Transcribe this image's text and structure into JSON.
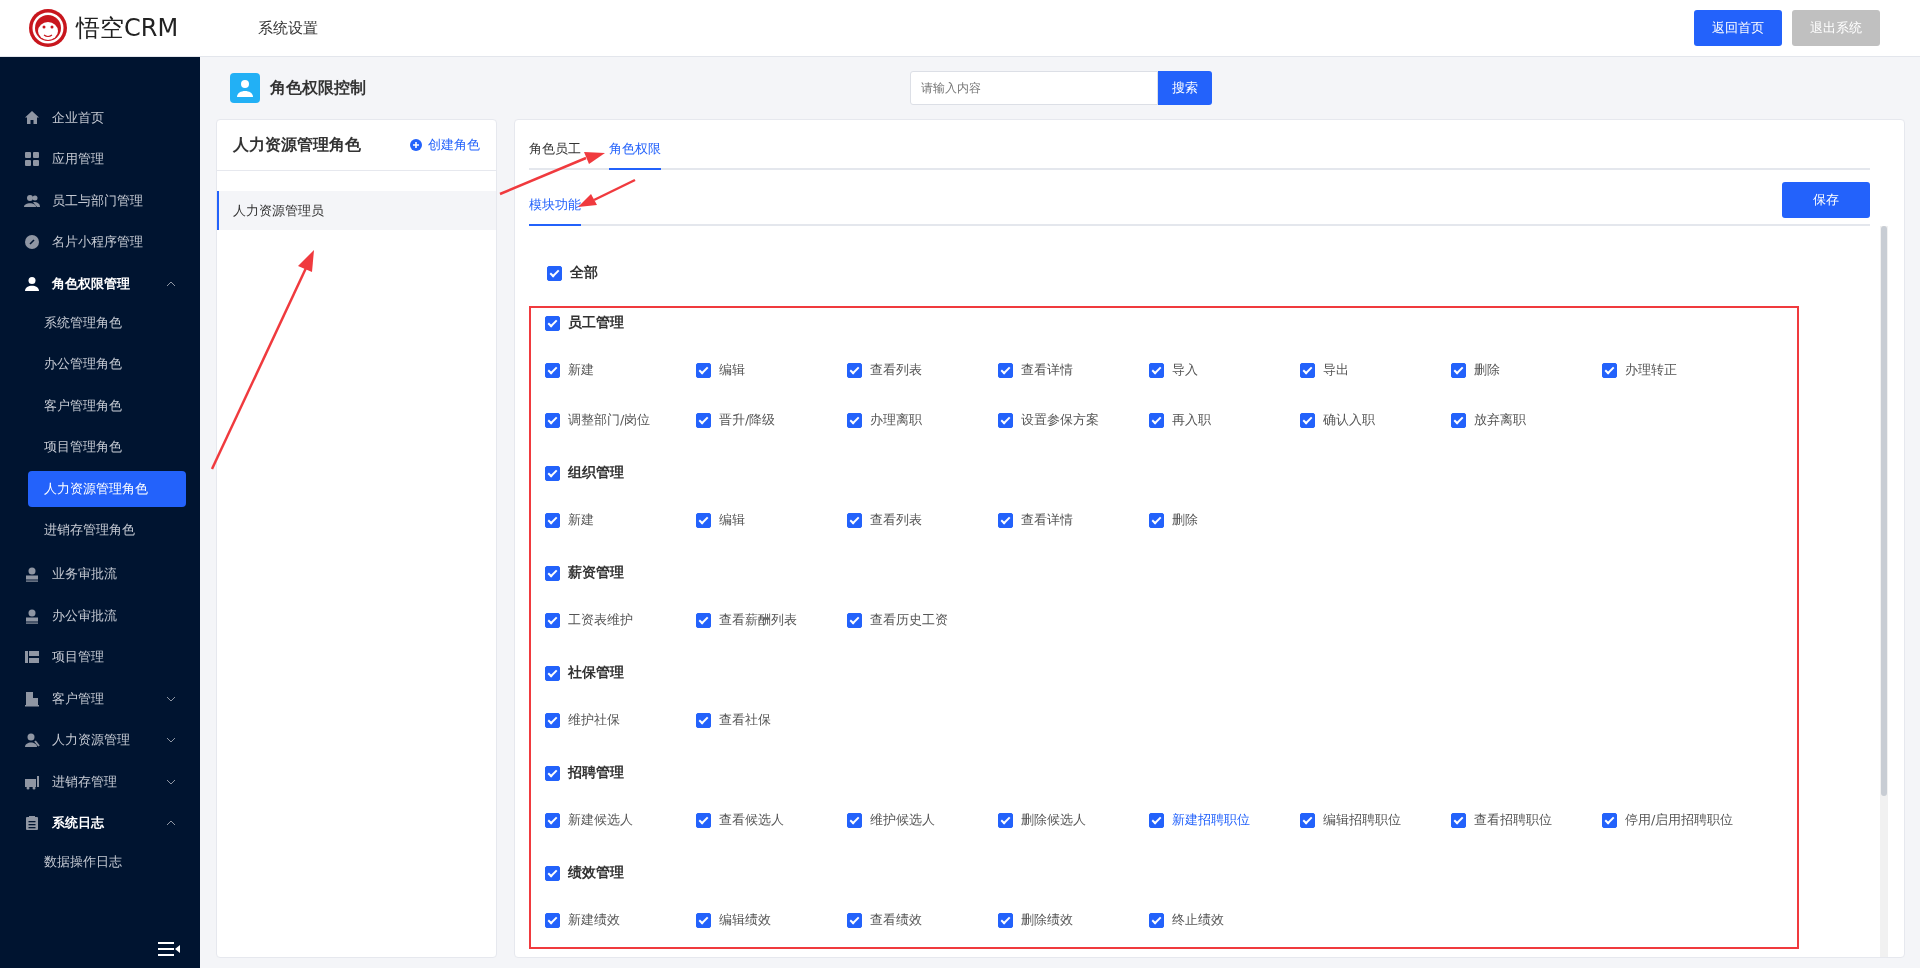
{
  "header": {
    "logo_text": "悟空CRM",
    "nav": [
      {
        "label": "系统设置"
      }
    ],
    "buttons": [
      {
        "label": "返回首页",
        "kind": "primary"
      },
      {
        "label": "退出系统",
        "kind": "muted"
      }
    ]
  },
  "sidebar": {
    "items": [
      {
        "label": "企业首页",
        "kind": "link"
      },
      {
        "label": "应用管理",
        "kind": "link"
      },
      {
        "label": "员工与部门管理",
        "kind": "link"
      },
      {
        "label": "名片小程序管理",
        "kind": "link"
      },
      {
        "label": "角色权限管理",
        "kind": "group",
        "expanded": true,
        "children": [
          {
            "label": "系统管理角色",
            "selected": false
          },
          {
            "label": "办公管理角色",
            "selected": false
          },
          {
            "label": "客户管理角色",
            "selected": false
          },
          {
            "label": "项目管理角色",
            "selected": false
          },
          {
            "label": "人力资源管理角色",
            "selected": true
          },
          {
            "label": "进销存管理角色",
            "selected": false
          }
        ]
      },
      {
        "label": "业务审批流",
        "kind": "link"
      },
      {
        "label": "办公审批流",
        "kind": "link"
      },
      {
        "label": "项目管理",
        "kind": "link"
      },
      {
        "label": "客户管理",
        "kind": "group",
        "expanded": false
      },
      {
        "label": "人力资源管理",
        "kind": "group",
        "expanded": false
      },
      {
        "label": "进销存管理",
        "kind": "group",
        "expanded": false
      },
      {
        "label": "系统日志",
        "kind": "group",
        "expanded": true,
        "children": [
          {
            "label": "数据操作日志",
            "selected": false
          }
        ]
      }
    ]
  },
  "page_title": "角色权限控制",
  "search": {
    "placeholder": "请输入内容",
    "button": "搜索"
  },
  "role_panel": {
    "title": "人力资源管理角色",
    "create_link": "创建角色",
    "roles": [
      {
        "label": "人力资源管理员",
        "selected": true
      }
    ]
  },
  "tabs": [
    {
      "label": "角色员工",
      "selected": false
    },
    {
      "label": "角色权限",
      "selected": true
    }
  ],
  "sub_tabs": [
    {
      "label": "模块功能",
      "selected": true
    }
  ],
  "save_button": "保存",
  "permissions": {
    "all": {
      "label": "全部",
      "checked": true
    },
    "groups": [
      {
        "label": "员工管理",
        "checked": true,
        "items": [
          {
            "label": "新建",
            "checked": true,
            "hovered": false
          },
          {
            "label": "编辑",
            "checked": true,
            "hovered": false
          },
          {
            "label": "查看列表",
            "checked": true,
            "hovered": false
          },
          {
            "label": "查看详情",
            "checked": true,
            "hovered": false
          },
          {
            "label": "导入",
            "checked": true,
            "hovered": false
          },
          {
            "label": "导出",
            "checked": true,
            "hovered": false
          },
          {
            "label": "删除",
            "checked": true,
            "hovered": false
          },
          {
            "label": "办理转正",
            "checked": true,
            "hovered": false
          },
          {
            "label": "调整部门/岗位",
            "checked": true,
            "hovered": false
          },
          {
            "label": "晋升/降级",
            "checked": true,
            "hovered": false
          },
          {
            "label": "办理离职",
            "checked": true,
            "hovered": false
          },
          {
            "label": "设置参保方案",
            "checked": true,
            "hovered": false
          },
          {
            "label": "再入职",
            "checked": true,
            "hovered": false
          },
          {
            "label": "确认入职",
            "checked": true,
            "hovered": false
          },
          {
            "label": "放弃离职",
            "checked": true,
            "hovered": false
          }
        ]
      },
      {
        "label": "组织管理",
        "checked": true,
        "items": [
          {
            "label": "新建",
            "checked": true,
            "hovered": false
          },
          {
            "label": "编辑",
            "checked": true,
            "hovered": false
          },
          {
            "label": "查看列表",
            "checked": true,
            "hovered": false
          },
          {
            "label": "查看详情",
            "checked": true,
            "hovered": false
          },
          {
            "label": "删除",
            "checked": true,
            "hovered": false
          }
        ]
      },
      {
        "label": "薪资管理",
        "checked": true,
        "items": [
          {
            "label": "工资表维护",
            "checked": true,
            "hovered": false
          },
          {
            "label": "查看薪酬列表",
            "checked": true,
            "hovered": false
          },
          {
            "label": "查看历史工资",
            "checked": true,
            "hovered": false
          }
        ]
      },
      {
        "label": "社保管理",
        "checked": true,
        "items": [
          {
            "label": "维护社保",
            "checked": true,
            "hovered": false
          },
          {
            "label": "查看社保",
            "checked": true,
            "hovered": false
          }
        ]
      },
      {
        "label": "招聘管理",
        "checked": true,
        "items": [
          {
            "label": "新建候选人",
            "checked": true,
            "hovered": false
          },
          {
            "label": "查看候选人",
            "checked": true,
            "hovered": false
          },
          {
            "label": "维护候选人",
            "checked": true,
            "hovered": false
          },
          {
            "label": "删除候选人",
            "checked": true,
            "hovered": false
          },
          {
            "label": "新建招聘职位",
            "checked": true,
            "hovered": true
          },
          {
            "label": "编辑招聘职位",
            "checked": true,
            "hovered": false
          },
          {
            "label": "查看招聘职位",
            "checked": true,
            "hovered": false
          },
          {
            "label": "停用/启用招聘职位",
            "checked": true,
            "hovered": false
          }
        ]
      },
      {
        "label": "绩效管理",
        "checked": true,
        "items": [
          {
            "label": "新建绩效",
            "checked": true,
            "hovered": false
          },
          {
            "label": "编辑绩效",
            "checked": true,
            "hovered": false
          },
          {
            "label": "查看绩效",
            "checked": true,
            "hovered": false
          },
          {
            "label": "删除绩效",
            "checked": true,
            "hovered": false
          },
          {
            "label": "终止绩效",
            "checked": true,
            "hovered": false
          }
        ]
      }
    ]
  }
}
